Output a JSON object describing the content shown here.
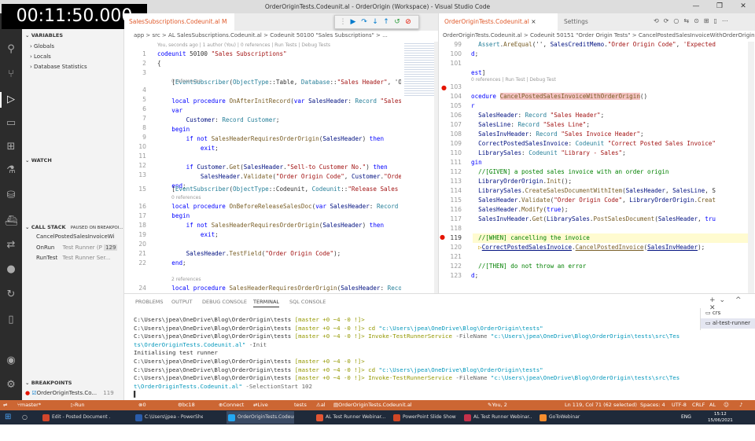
{
  "timer": "00:11:50.000",
  "window_title": "OrderOriginTests.Codeunit.al - OrderOrigin (Workspace) - Visual Studio Code",
  "sidebar": {
    "variables_header": "VARIABLES",
    "variables": [
      "Globals",
      "Locals",
      "Database Statistics"
    ],
    "watch_header": "WATCH",
    "callstack_header": "CALL STACK",
    "callstack_status": "PAUSED ON BREAKPOI...",
    "callstack": [
      {
        "name": "CancelPostedSalesInvoiceWi",
        "source": "",
        "line": ""
      },
      {
        "name": "OnRun",
        "source": "Test Runner (P",
        "line": "129"
      },
      {
        "name": "RunTest",
        "source": "Test Runner Ser...",
        "line": ""
      }
    ],
    "breakpoints_header": "BREAKPOINTS",
    "breakpoint_file": "OrderOriginTests.Co...",
    "breakpoint_line": "119"
  },
  "left_editor": {
    "tab": "SalesSubscriptions.Codeunit.al M",
    "breadcrumb": "app > src > AL SalesSubscriptions.Codeunit.al > Codeunit 50100 \"Sales Subscriptions\" > ...",
    "lens_top": "You, seconds ago | 1 author (You) | 0 references | Run Tests | Debug Tests",
    "ref0": "0 references",
    "ref2": "2 references"
  },
  "right_editor": {
    "tab1": "OrderOriginTests.Codeunit.al",
    "tab2": "Settings",
    "breadcrumb": "OrderOriginTests.Codeunit.al > Codeunit 50151 \"Order Origin Tests\" > CancelPostedSalesInvoiceWithOrderOrigin()",
    "lens": "0 references | Run Test | Debug Test"
  },
  "panel": {
    "tabs": [
      "PROBLEMS",
      "OUTPUT",
      "DEBUG CONSOLE",
      "TERMINAL",
      "SQL CONSOLE"
    ],
    "terminals": [
      "crs",
      "al-test-runner"
    ],
    "prompt": "C:\\Users\\jpea\\OneDrive\\Blog\\OrderOrigin\\tests",
    "branch": "[master +0 ~4 -0 !]>",
    "cd_cmd": "cd",
    "cd_arg": "\"c:\\Users\\jpea\\OneDrive\\Blog\\OrderOrigin\\tests\"",
    "invoke": "Invoke-TestRunnerService",
    "filename_flag": "-FileName",
    "filename_arg_1": "\"c:\\Users\\jpea\\OneDrive\\Blog\\OrderOrigin\\tests\\src\\Tes",
    "filename_arg_2": "ts\\OrderOriginTests.Codeunit.al\"",
    "init_flag": "-Init",
    "initialising": "Initialising test runner",
    "filename_arg_3": "t\\OrderOriginTests.Codeunit.al\"",
    "selection": "-SelectionStart 102"
  },
  "status": {
    "branch": "master*",
    "run": "Run In Web Client",
    "errors": "0 ▲ 0",
    "bc": "bc18 (tests)",
    "connect": "Connect",
    "liveshare": "Live Share",
    "tests": "tests",
    "al": "al",
    "file": "OrderOriginTests.Codeunit.al",
    "blame": "You, 2 months ago",
    "pos": "Ln 119, Col 71 (62 selected)",
    "spaces": "Spaces: 4",
    "enc": "UTF-8",
    "eol": "CRLF",
    "lang": "AL"
  },
  "taskbar": {
    "items": [
      "Edit - Posted Document ...",
      "C:\\Users\\jpea - PowerShe...",
      "OrderOriginTests.Codeun...",
      "AL Test Runner Webinar...",
      "PowerPoint Slide Show -...",
      "AL Test Runner Webinar...",
      "GoToWebinar"
    ],
    "lang": "ENG",
    "time": "15:12",
    "date": "15/06/2021"
  },
  "colors": {
    "status_bar": "#cc6633",
    "activity_bar": "#2c2c2c",
    "breakpoint": "#e51400",
    "taskbar": "#1f2a3a"
  }
}
